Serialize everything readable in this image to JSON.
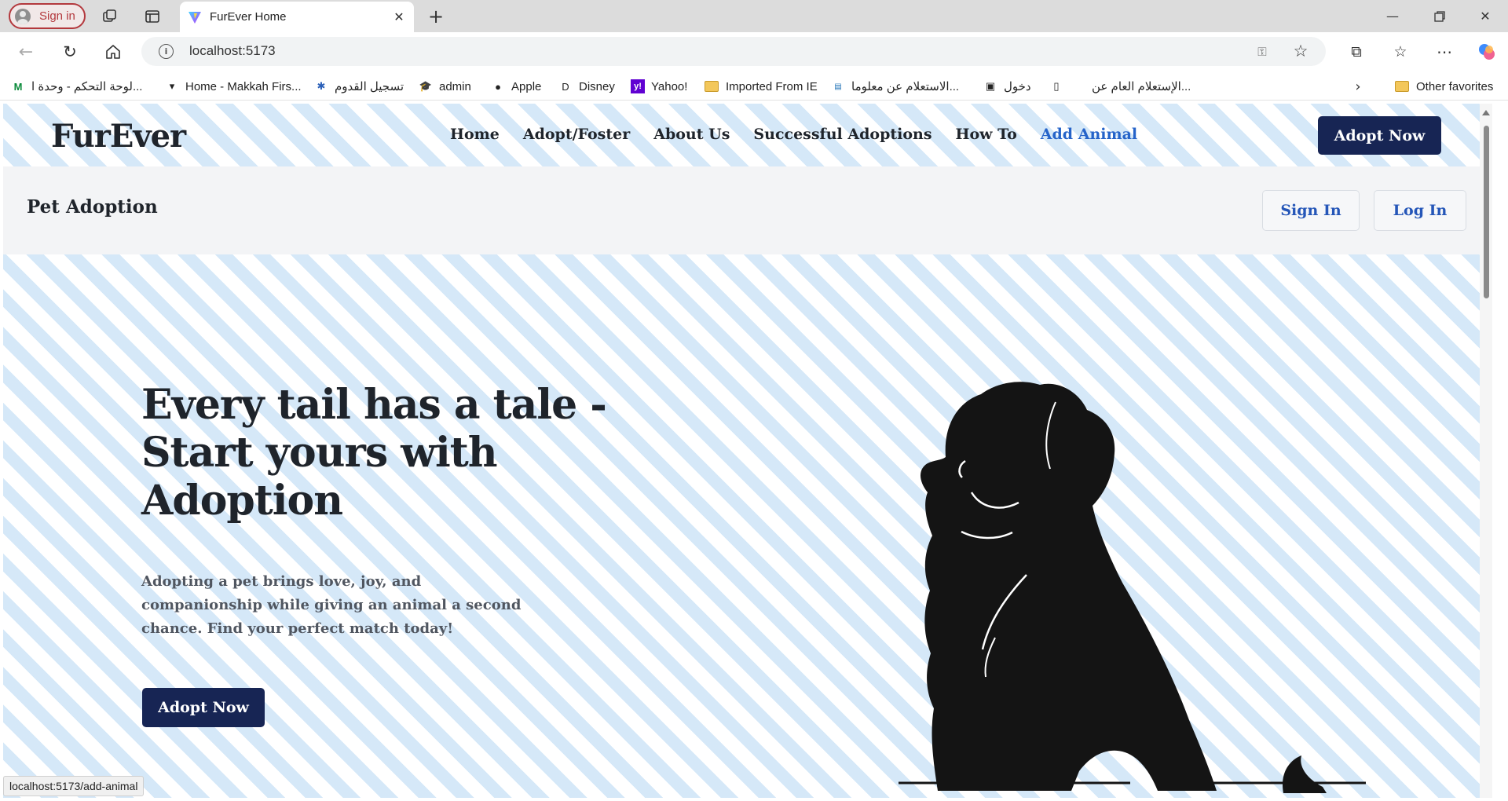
{
  "browser": {
    "profile_label": "Sign in",
    "tab_title": "FurEver Home",
    "url": "localhost:5173",
    "status_url": "localhost:5173/add-animal"
  },
  "bookmarks": [
    {
      "label": "لوحة التحكم - وحدة ا..."
    },
    {
      "label": "Home - Makkah Firs..."
    },
    {
      "label": "تسجيل القدوم"
    },
    {
      "label": "admin"
    },
    {
      "label": "Apple"
    },
    {
      "label": "Disney"
    },
    {
      "label": "Yahoo!"
    },
    {
      "label": "Imported From IE"
    },
    {
      "label": "الاستعلام عن معلوما..."
    },
    {
      "label": "دخول"
    },
    {
      "label": "الإستعلام العام عن..."
    },
    {
      "label": "Other favorites"
    }
  ],
  "site": {
    "logo": "FurEver",
    "nav": [
      "Home",
      "Adopt/Foster",
      "About Us",
      "Successful Adoptions",
      "How To",
      "Add Animal"
    ],
    "nav_cta": "Adopt Now",
    "subbar": {
      "brand": "Pet Adoption",
      "signin": "Sign In",
      "login": "Log In"
    },
    "hero": {
      "title_line1": "Every tail has a tale -",
      "title_line2": "Start yours with",
      "title_line3": "Adoption",
      "text": "Adopting a pet brings love, joy, and companionship while giving an animal a second chance. Find your perfect match today!",
      "cta": "Adopt Now"
    }
  },
  "colors": {
    "accent_dark": "#172554",
    "link_active": "#2563c9",
    "pattern_blue": "#b3d6f3"
  }
}
